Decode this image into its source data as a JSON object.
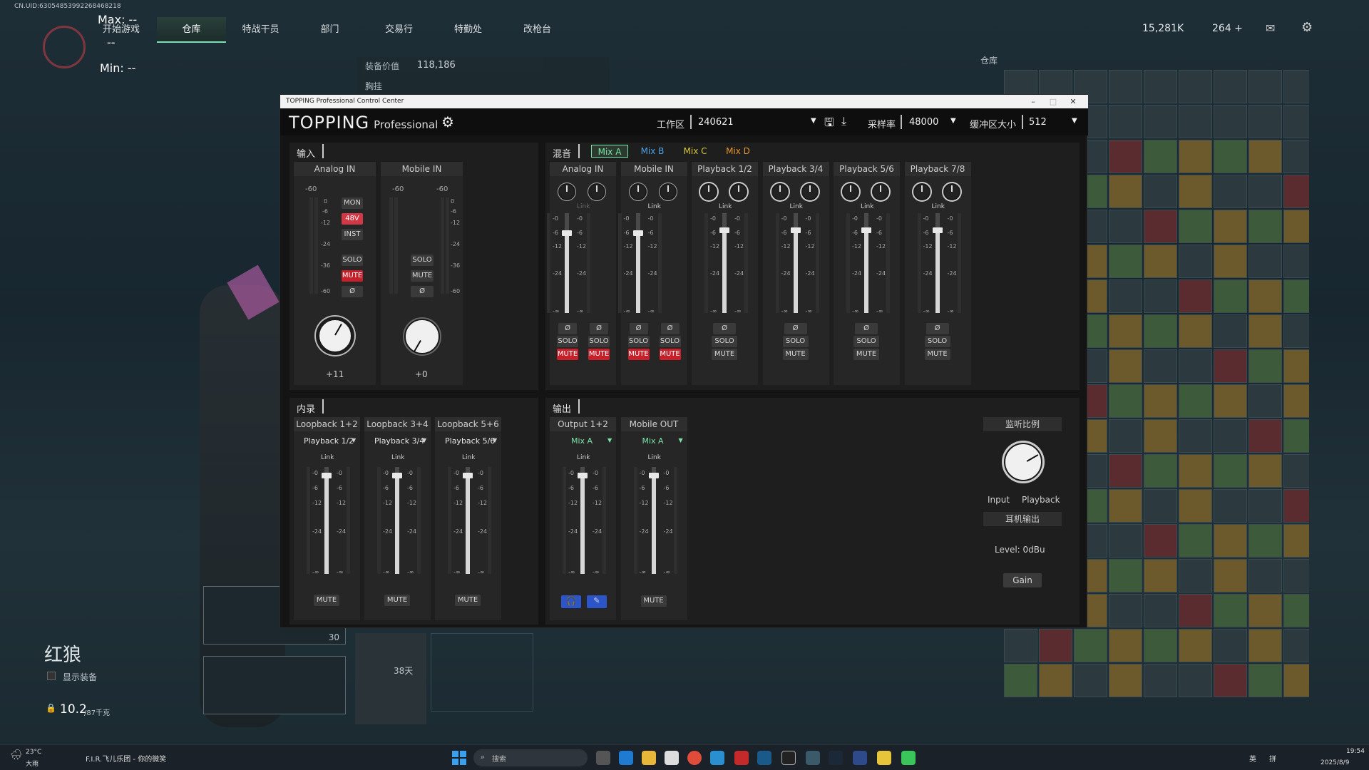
{
  "game": {
    "uid": "CN.UID:63054853992268468218",
    "nav": [
      "开始游戏",
      "仓库",
      "特战干员",
      "部门",
      "交易行",
      "特勤处",
      "改枪台"
    ],
    "nav_active": 1,
    "max_label": "Max: --",
    "min_label": "Min: --",
    "dash": "--",
    "equip_value_label": "装备价值",
    "equip_value": "118,186",
    "chest_label": "胸挂",
    "currency1": "15,281K",
    "currency2": "264 +",
    "warehouse_label": "仓库",
    "character_name": "红狼",
    "show_equip": "显示装备",
    "weight": "10.2",
    "weight_unit": "/87千克",
    "ammo": "30",
    "days": "38天"
  },
  "taskbar": {
    "weather_temp": "23°C",
    "weather_text": "大雨",
    "media": "F.I.R.飞儿乐团 - 你的微笑",
    "search_placeholder": "搜索",
    "ime1": "英",
    "ime2": "拼",
    "time": "19:54",
    "date": "2025/8/9"
  },
  "window": {
    "title": "TOPPING Professional Control Center",
    "brand": "TOPPING",
    "brand_sub": "Professional",
    "workspace_label": "工作区",
    "workspace_value": "240621",
    "samplerate_label": "采样率",
    "samplerate_value": "48000",
    "buffer_label": "缓冲区大小",
    "buffer_value": "512"
  },
  "input": {
    "title": "输入",
    "analog": {
      "label": "Analog IN",
      "mon": "MON",
      "p48": "48V",
      "inst": "INST",
      "solo": "SOLO",
      "mute": "MUTE",
      "phase": "Ø",
      "gain": "+11",
      "scale": [
        "-60",
        "0",
        "-6",
        "-12",
        "-24",
        "-36",
        "-60"
      ]
    },
    "mobile": {
      "label": "Mobile IN",
      "solo": "SOLO",
      "mute": "MUTE",
      "phase": "Ø",
      "gain": "+0",
      "scale": [
        "-60",
        "-60",
        "0",
        "-6",
        "-12",
        "-24",
        "-36",
        "-60"
      ]
    }
  },
  "mix": {
    "title": "混音",
    "tabs": [
      {
        "label": "Mix A",
        "color": "#7de3a8"
      },
      {
        "label": "Mix B",
        "color": "#4fa3e8"
      },
      {
        "label": "Mix C",
        "color": "#d7c93a"
      },
      {
        "label": "Mix D",
        "color": "#e6962f"
      }
    ],
    "channels": [
      {
        "label": "Analog IN",
        "link": "Link",
        "phase": "Ø",
        "solo": "SOLO",
        "mute": "MUTE",
        "muted": true
      },
      {
        "label": "Mobile IN",
        "link": "Link",
        "phase": "Ø",
        "solo": "SOLO",
        "mute": "MUTE",
        "muted": true
      },
      {
        "label": "Playback 1/2",
        "link": "Link",
        "phase": "Ø",
        "solo": "SOLO",
        "mute": "MUTE",
        "muted": false
      },
      {
        "label": "Playback 3/4",
        "link": "Link",
        "phase": "Ø",
        "solo": "SOLO",
        "mute": "MUTE",
        "muted": false
      },
      {
        "label": "Playback 5/6",
        "link": "Link",
        "phase": "Ø",
        "solo": "SOLO",
        "mute": "MUTE",
        "muted": false
      },
      {
        "label": "Playback 7/8",
        "link": "Link",
        "phase": "Ø",
        "solo": "SOLO",
        "mute": "MUTE",
        "muted": false
      }
    ],
    "scale": [
      "-0",
      "-6",
      "-12",
      "-24",
      "-∞"
    ]
  },
  "loopback": {
    "title": "内录",
    "channels": [
      {
        "label": "Loopback 1+2",
        "source": "Playback 1/2",
        "link": "Link",
        "mute": "MUTE"
      },
      {
        "label": "Loopback 3+4",
        "source": "Playback 3/4",
        "link": "Link",
        "mute": "MUTE"
      },
      {
        "label": "Loopback 5+6",
        "source": "Playback 5/6",
        "link": "Link",
        "mute": "MUTE"
      }
    ]
  },
  "output": {
    "title": "输出",
    "channels": [
      {
        "label": "Output 1+2",
        "source": "Mix A",
        "link": "Link"
      },
      {
        "label": "Mobile OUT",
        "source": "Mix A",
        "link": "Link",
        "mute": "MUTE"
      }
    ]
  },
  "monitor": {
    "ratio_label": "监听比例",
    "input_label": "Input",
    "playback_label": "Playback",
    "headphone_label": "耳机输出",
    "level": "Level: 0dBu",
    "gain_btn": "Gain"
  }
}
